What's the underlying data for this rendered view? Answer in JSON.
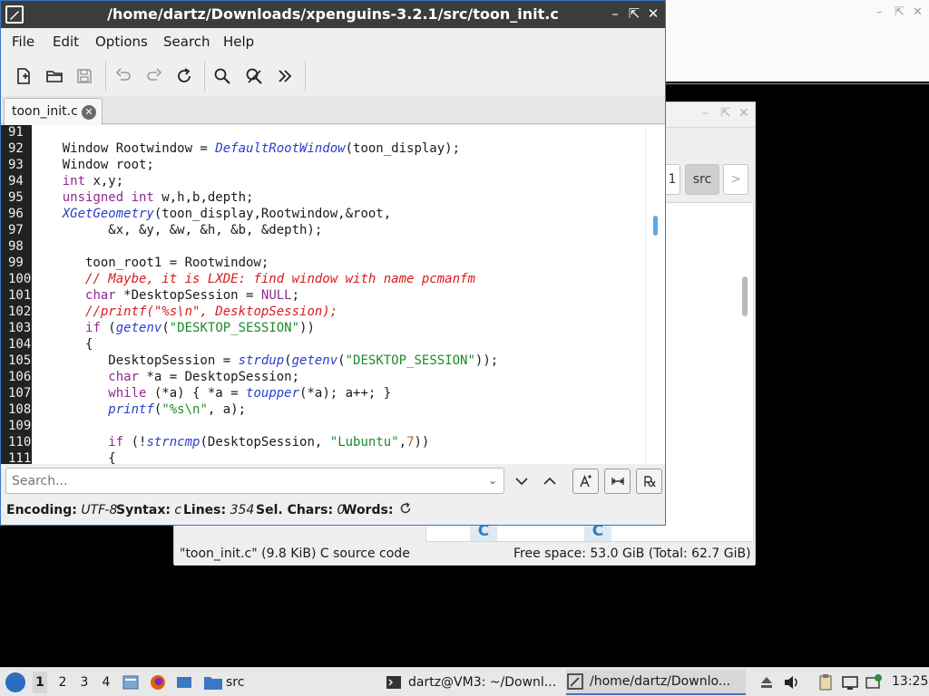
{
  "editor": {
    "title": "/home/dartz/Downloads/xpenguins-3.2.1/src/toon_init.c",
    "menu": [
      "File",
      "Edit",
      "Options",
      "Search",
      "Help"
    ],
    "toolbar": {
      "new": "new-file-icon",
      "open": "open-folder-icon",
      "save": "save-icon",
      "undo": "undo-icon",
      "redo": "redo-icon",
      "reload": "reload-icon",
      "find": "search-icon",
      "replace": "find-replace-icon",
      "more": "overflow-icon"
    },
    "tab": {
      "label": "toon_init.c"
    },
    "lines": [
      {
        "n": "91",
        "segs": []
      },
      {
        "n": "92",
        "segs": [
          [
            "",
            "    Window Rootwindow = "
          ],
          [
            "fn",
            "DefaultRootWindow"
          ],
          [
            "",
            "(toon_display);"
          ]
        ]
      },
      {
        "n": "93",
        "segs": [
          [
            "",
            "    Window root;"
          ]
        ]
      },
      {
        "n": "94",
        "segs": [
          [
            "",
            "    "
          ],
          [
            "kw",
            "int"
          ],
          [
            "",
            " x,y;"
          ]
        ]
      },
      {
        "n": "95",
        "segs": [
          [
            "",
            "    "
          ],
          [
            "kw",
            "unsigned int"
          ],
          [
            "",
            " w,h,b,depth;"
          ]
        ]
      },
      {
        "n": "96",
        "segs": [
          [
            "",
            "    "
          ],
          [
            "fn",
            "XGetGeometry"
          ],
          [
            "",
            "(toon_display,Rootwindow,&root,"
          ]
        ]
      },
      {
        "n": "97",
        "segs": [
          [
            "",
            "          &x, &y, &w, &h, &b, &depth);"
          ]
        ]
      },
      {
        "n": "98",
        "segs": []
      },
      {
        "n": "99",
        "segs": [
          [
            "",
            "       toon_root1 = Rootwindow;"
          ]
        ]
      },
      {
        "n": "100",
        "segs": [
          [
            "",
            "       "
          ],
          [
            "cm",
            "// Maybe, it is LXDE: find window with name pcmanfm"
          ]
        ]
      },
      {
        "n": "101",
        "segs": [
          [
            "",
            "       "
          ],
          [
            "kw",
            "char"
          ],
          [
            "",
            " *DesktopSession = "
          ],
          [
            "kw",
            "NULL"
          ],
          [
            "",
            ";"
          ]
        ]
      },
      {
        "n": "102",
        "segs": [
          [
            "",
            "       "
          ],
          [
            "cm",
            "//printf(\"%s\\n\", DesktopSession);"
          ]
        ]
      },
      {
        "n": "103",
        "segs": [
          [
            "",
            "       "
          ],
          [
            "kw",
            "if"
          ],
          [
            "",
            " ("
          ],
          [
            "fn",
            "getenv"
          ],
          [
            "",
            "("
          ],
          [
            "str",
            "\"DESKTOP_SESSION\""
          ],
          [
            "",
            "))"
          ]
        ]
      },
      {
        "n": "104",
        "segs": [
          [
            "",
            "       {"
          ]
        ]
      },
      {
        "n": "105",
        "segs": [
          [
            "",
            "          DesktopSession = "
          ],
          [
            "fn",
            "strdup"
          ],
          [
            "",
            "("
          ],
          [
            "fn",
            "getenv"
          ],
          [
            "",
            "("
          ],
          [
            "str",
            "\"DESKTOP_SESSION\""
          ],
          [
            "",
            "));"
          ]
        ]
      },
      {
        "n": "106",
        "segs": [
          [
            "",
            "          "
          ],
          [
            "kw",
            "char"
          ],
          [
            "",
            " *a = DesktopSession;"
          ]
        ]
      },
      {
        "n": "107",
        "segs": [
          [
            "",
            "          "
          ],
          [
            "kw",
            "while"
          ],
          [
            "",
            " (*a) { *a = "
          ],
          [
            "fn",
            "toupper"
          ],
          [
            "",
            "(*a); a++; }"
          ]
        ]
      },
      {
        "n": "108",
        "segs": [
          [
            "",
            "          "
          ],
          [
            "fn",
            "printf"
          ],
          [
            "",
            "("
          ],
          [
            "str",
            "\"%s\\n\""
          ],
          [
            "",
            ", a);"
          ]
        ]
      },
      {
        "n": "109",
        "segs": []
      },
      {
        "n": "110",
        "segs": [
          [
            "",
            "          "
          ],
          [
            "kw",
            "if"
          ],
          [
            "",
            " (!"
          ],
          [
            "fn",
            "strncmp"
          ],
          [
            "",
            "(DesktopSession, "
          ],
          [
            "str",
            "\"Lubuntu\""
          ],
          [
            "",
            ","
          ],
          [
            "num",
            "7"
          ],
          [
            "",
            "))"
          ]
        ]
      },
      {
        "n": "111",
        "segs": [
          [
            "",
            "          {"
          ]
        ]
      }
    ],
    "search": {
      "placeholder": "Search..."
    },
    "status": {
      "encoding_label": "Encoding:",
      "encoding": "UTF-8",
      "syntax_label": "Syntax:",
      "syntax": "c",
      "lines_label": "Lines:",
      "lines": "354",
      "sel_label": "Sel. Chars:",
      "sel": "0",
      "words_label": "Words:"
    }
  },
  "filemanager": {
    "path": {
      "prev_partial": "1",
      "current": "src",
      "next": ">"
    },
    "file_icon_letter": "C",
    "status_left": "\"toon_init.c\" (9.8 KiB) C source code",
    "status_right": "Free space: 53.0 GiB (Total: 62.7 GiB)"
  },
  "taskbar": {
    "workspaces": [
      "1",
      "2",
      "3",
      "4"
    ],
    "folder_task": "src",
    "tasks": [
      {
        "label": "dartz@VM3: ~/Downl...",
        "icon": "terminal-icon"
      },
      {
        "label": "/home/dartz/Downlo...",
        "icon": "editor-icon"
      }
    ],
    "clock": "13:25"
  },
  "colors": {
    "accent": "#3a78c4",
    "titlebar": "#3c3c3c",
    "keyword": "#8f2b8f",
    "function": "#2b3fc8",
    "string": "#1e8a2c",
    "comment": "#d81b1b"
  }
}
